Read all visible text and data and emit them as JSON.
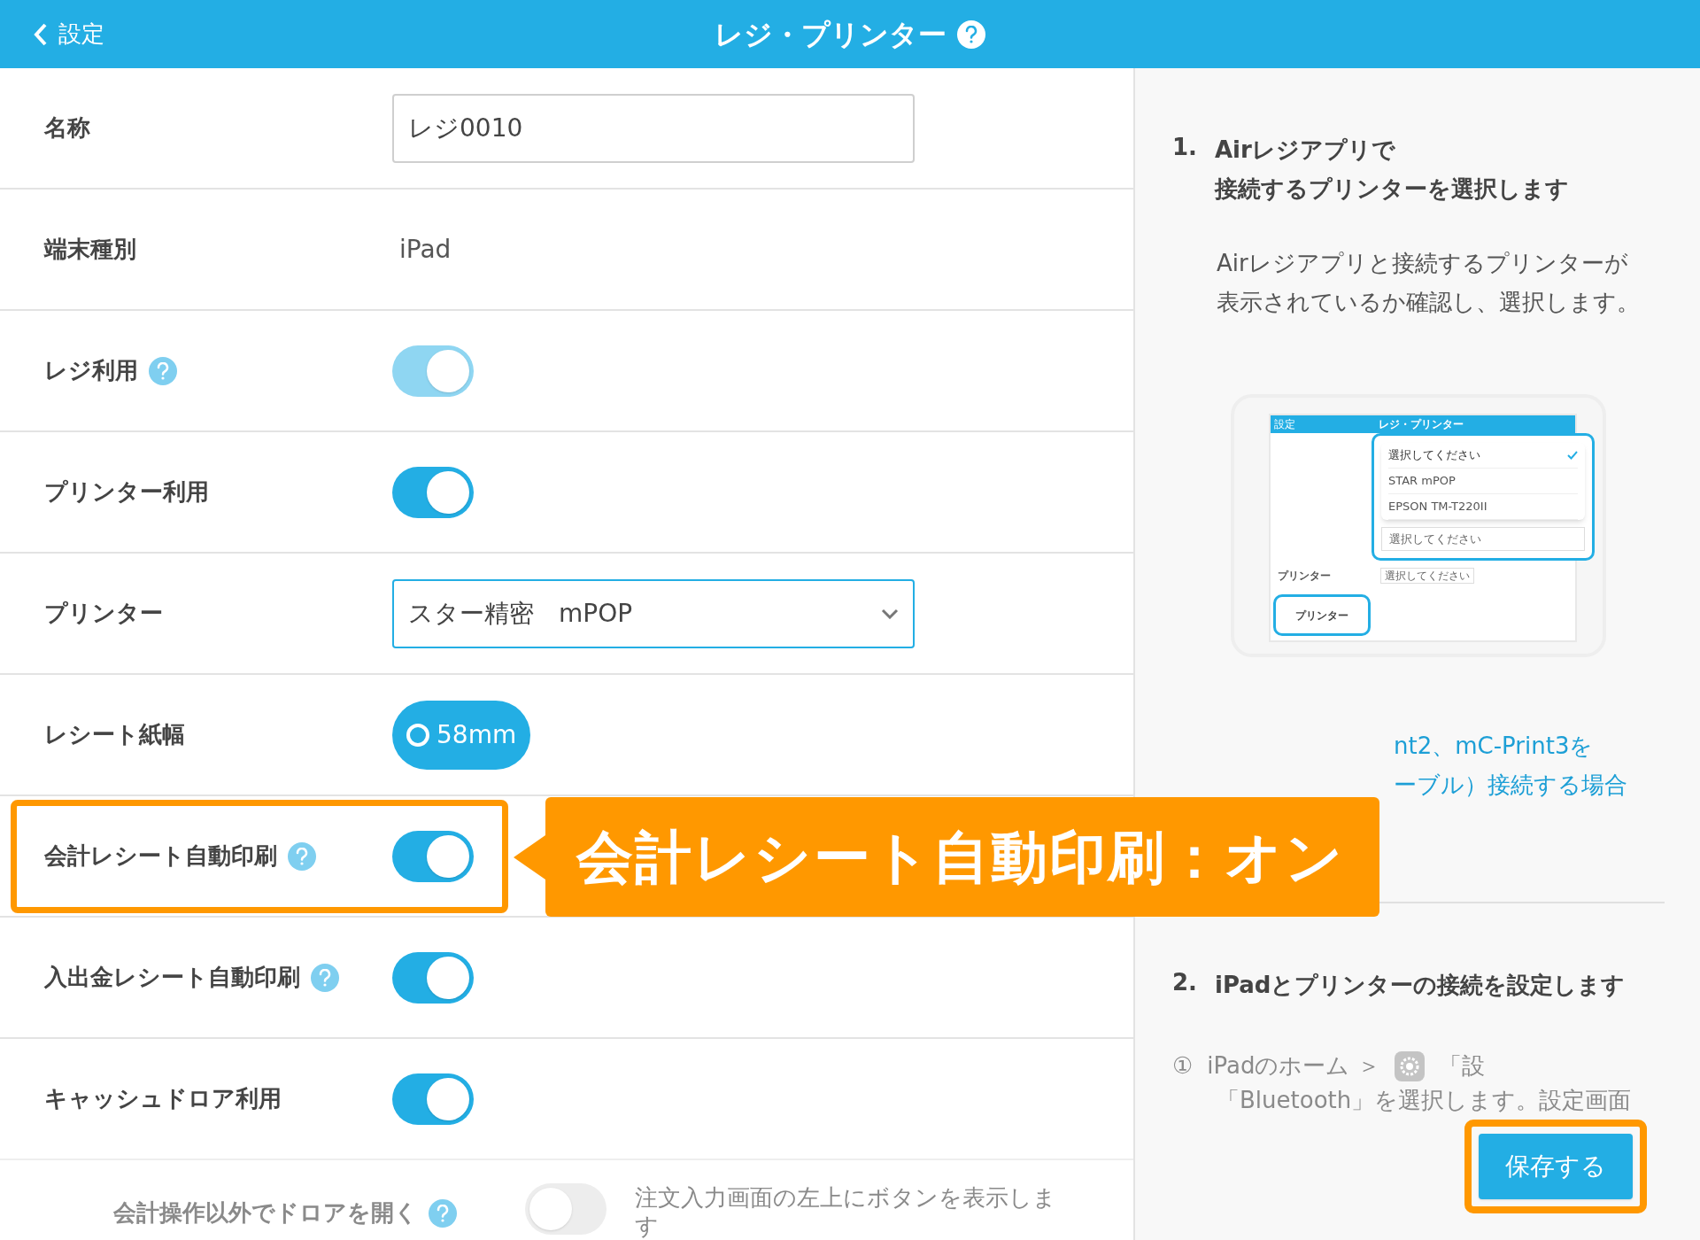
{
  "header": {
    "back_label": "設定",
    "title": "レジ・プリンター"
  },
  "rows": [
    {
      "kind": "text_field",
      "label": "名称",
      "value": "レジ0010"
    },
    {
      "kind": "static",
      "label": "端末種別",
      "value": "iPad"
    },
    {
      "kind": "toggle",
      "label": "レジ利用",
      "help": true,
      "on": true,
      "disabled": true
    },
    {
      "kind": "toggle",
      "label": "プリンター利用",
      "help": false,
      "on": true,
      "disabled": false
    },
    {
      "kind": "select",
      "label": "プリンター",
      "value": "スター精密　mPOP"
    },
    {
      "kind": "radio",
      "label": "レシート紙幅",
      "options": [
        {
          "label": "58mm",
          "selected": true
        }
      ]
    },
    {
      "kind": "toggle",
      "label": "会計レシート自動印刷",
      "help": true,
      "on": true,
      "disabled": false,
      "highlighted": true
    },
    {
      "kind": "toggle",
      "label": "入出金レシート自動印刷",
      "help": true,
      "on": true,
      "disabled": false
    },
    {
      "kind": "toggle",
      "label": "キャッシュドロア利用",
      "help": false,
      "on": true,
      "disabled": false
    },
    {
      "kind": "toggle",
      "label": "会計操作以外でドロアを開く",
      "help": true,
      "on": false,
      "disabled": true,
      "description": "注文入力画面の左上にボタンを表示します"
    }
  ],
  "callout": {
    "text": "会計レシート自動印刷：オン"
  },
  "guide": {
    "steps": [
      {
        "number": "1.",
        "title_lines": [
          "Airレジアプリで",
          "接続するプリンターを選択します"
        ],
        "body": "Airレジアプリと接続するプリンターが表示されているか確認し、選択します。",
        "illustration": {
          "title": "レジ・プリンター",
          "back_label": "設定",
          "menu_items": [
            {
              "label": "選択してください",
              "selected": true
            },
            {
              "label": "STAR mPOP",
              "selected": false
            },
            {
              "label": "EPSON TM-T220II",
              "selected": false
            }
          ],
          "select_placeholder": "選択してください",
          "small_select": "選択してください",
          "row_label": "プリンター",
          "bubble": "プリンター"
        },
        "links": [
          "nt2、mC-Print3を",
          "ーブル）接続する場合"
        ]
      },
      {
        "number": "2.",
        "title_lines": [
          "iPadとプリンターの接続を設定します"
        ],
        "substeps": [
          {
            "marker": "①",
            "before": "iPadのホーム ＞",
            "after": "「設",
            "line2": "「Bluetooth」を選択します。設定画面"
          }
        ]
      }
    ]
  },
  "save_button": {
    "label": "保存する",
    "highlighted": true
  }
}
